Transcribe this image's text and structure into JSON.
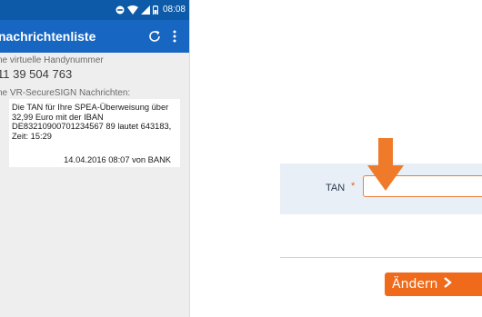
{
  "phone": {
    "status_bar": {
      "time": "08:08",
      "icons": [
        "minus-circle-icon",
        "wifi-icon",
        "signal-icon",
        "battery-icon"
      ]
    },
    "app_bar": {
      "title": "nachrichtenliste",
      "actions": [
        "refresh-icon",
        "overflow-menu-icon"
      ]
    },
    "virtual_number_label": "ne virtuelle Handynummer",
    "virtual_number": "11 39 504 763",
    "messages_label": "ne VR-SecureSIGN Nachrichten:",
    "message": {
      "text": "Die TAN für Ihre SPEA-Überweisung über 32,99 Euro mit der IBAN DE83210900701234567 89 lautet 643183, Zeit: 15:29",
      "meta": "14.04.2016 08:07  von BANK"
    }
  },
  "web_form": {
    "tan_label": "TAN",
    "required_marker": "*",
    "tan_value": "",
    "submit_label": "Ändern",
    "accent_color": "#ef6a1a"
  }
}
